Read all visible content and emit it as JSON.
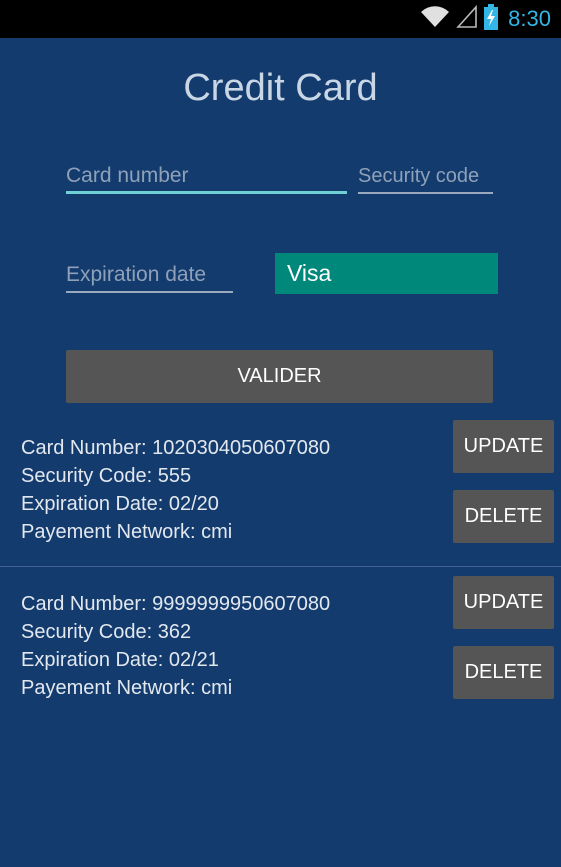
{
  "status_bar": {
    "time": "8:30",
    "icons": [
      "wifi-icon",
      "signal-icon",
      "battery-charging-icon"
    ]
  },
  "form": {
    "title": "Credit Card",
    "card_number_placeholder": "Card number",
    "security_code_placeholder": "Security code",
    "expiration_date_placeholder": "Expiration date",
    "network_selected": "Visa",
    "submit_label": "VALIDER"
  },
  "cards": [
    {
      "card_number": "Card Number: 1020304050607080",
      "security_code": "Security Code: 555",
      "expiration_date": "Expiration Date: 02/20",
      "network": "Payement Network: cmi",
      "update_label": "UPDATE",
      "delete_label": "DELETE"
    },
    {
      "card_number": "Card Number: 9999999950607080",
      "security_code": "Security Code: 362",
      "expiration_date": "Expiration Date: 02/21",
      "network": "Payement Network: cmi",
      "update_label": "UPDATE",
      "delete_label": "DELETE"
    }
  ],
  "colors": {
    "background": "#133b6e",
    "accent": "#00897b",
    "button": "#555555",
    "status_time": "#33b5e5"
  }
}
